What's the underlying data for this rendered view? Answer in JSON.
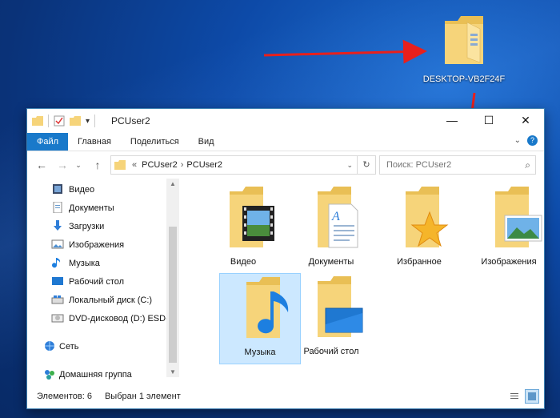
{
  "desktop": {
    "computer_label": "DESKTOP-VB2F24F"
  },
  "window": {
    "title": "PCUser2",
    "controls": {
      "minimize": "—",
      "maximize": "☐",
      "close": "✕"
    }
  },
  "ribbon": {
    "tabs": [
      "Файл",
      "Главная",
      "Поделиться",
      "Вид"
    ],
    "expand_icon": "chevron-down-icon",
    "help_icon": "help-icon"
  },
  "address": {
    "prefix": "«",
    "crumbs": [
      "PCUser2",
      "PCUser2"
    ],
    "separator": "›"
  },
  "search": {
    "placeholder": "Поиск: PCUser2"
  },
  "sidebar": {
    "items": [
      {
        "label": "Видео",
        "icon": "video-icon"
      },
      {
        "label": "Документы",
        "icon": "documents-icon"
      },
      {
        "label": "Загрузки",
        "icon": "downloads-icon"
      },
      {
        "label": "Изображения",
        "icon": "pictures-icon"
      },
      {
        "label": "Музыка",
        "icon": "music-icon"
      },
      {
        "label": "Рабочий стол",
        "icon": "desktop-icon"
      },
      {
        "label": "Локальный диск (C:)",
        "icon": "drive-icon"
      },
      {
        "label": "DVD-дисковод (D:) ESD-",
        "icon": "dvd-icon"
      },
      {
        "label": "Сеть",
        "icon": "network-icon"
      },
      {
        "label": "Домашняя группа",
        "icon": "homegroup-icon"
      }
    ]
  },
  "folders": [
    {
      "label": "Видео",
      "icon": "video-folder-icon"
    },
    {
      "label": "Документы",
      "icon": "documents-folder-icon"
    },
    {
      "label": "Избранное",
      "icon": "favorites-folder-icon"
    },
    {
      "label": "Изображения",
      "icon": "pictures-folder-icon"
    },
    {
      "label": "Музыка",
      "icon": "music-folder-icon",
      "selected": true
    },
    {
      "label": "Рабочий стол",
      "icon": "desktop-folder-icon"
    }
  ],
  "status": {
    "count": "Элементов: 6",
    "selected": "Выбран 1 элемент"
  },
  "colors": {
    "accent": "#1979ca",
    "selection": "#cce8ff",
    "folder": "#f6d47a",
    "arrow": "#e8201c"
  }
}
